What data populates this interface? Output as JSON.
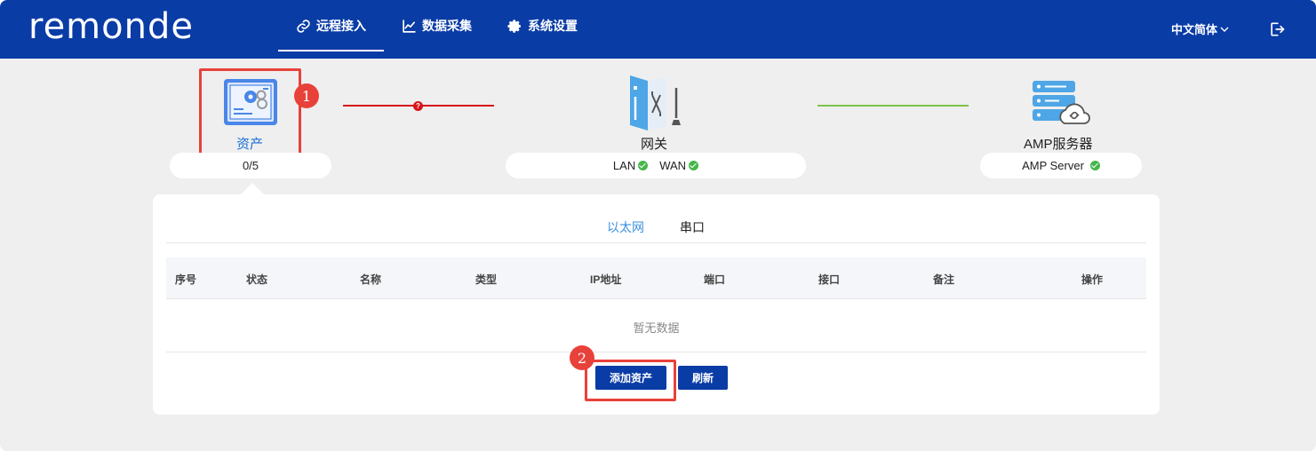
{
  "header": {
    "logo": "remonde",
    "nav": [
      {
        "label": "远程接入",
        "icon": "link-icon",
        "active": true
      },
      {
        "label": "数据采集",
        "icon": "chart-icon",
        "active": false
      },
      {
        "label": "系统设置",
        "icon": "gear-icon",
        "active": false
      }
    ],
    "language": "中文简体",
    "logout_icon": "logout-icon"
  },
  "topology": {
    "asset": {
      "label": "资产",
      "status": "0/5",
      "marker": "1"
    },
    "gateway": {
      "label": "网关",
      "lan": "LAN",
      "wan": "WAN"
    },
    "server": {
      "label": "AMP服务器",
      "status": "AMP Server"
    },
    "error_badge": "?",
    "colors": {
      "error_line": "#d7141a",
      "ok_line": "#7cc24d",
      "ok_check": "#45b649"
    }
  },
  "panel": {
    "tabs": [
      {
        "label": "以太网",
        "active": true
      },
      {
        "label": "串口",
        "active": false
      }
    ],
    "columns": [
      "序号",
      "状态",
      "名称",
      "类型",
      "IP地址",
      "端口",
      "接口",
      "备注",
      "操作"
    ],
    "empty_text": "暂无数据",
    "buttons": {
      "add": "添加资产",
      "refresh": "刷新"
    },
    "marker": "2"
  },
  "colors": {
    "brand": "#0a3ca6",
    "highlight": "#e8413a",
    "tab_active": "#3d8fe0"
  }
}
